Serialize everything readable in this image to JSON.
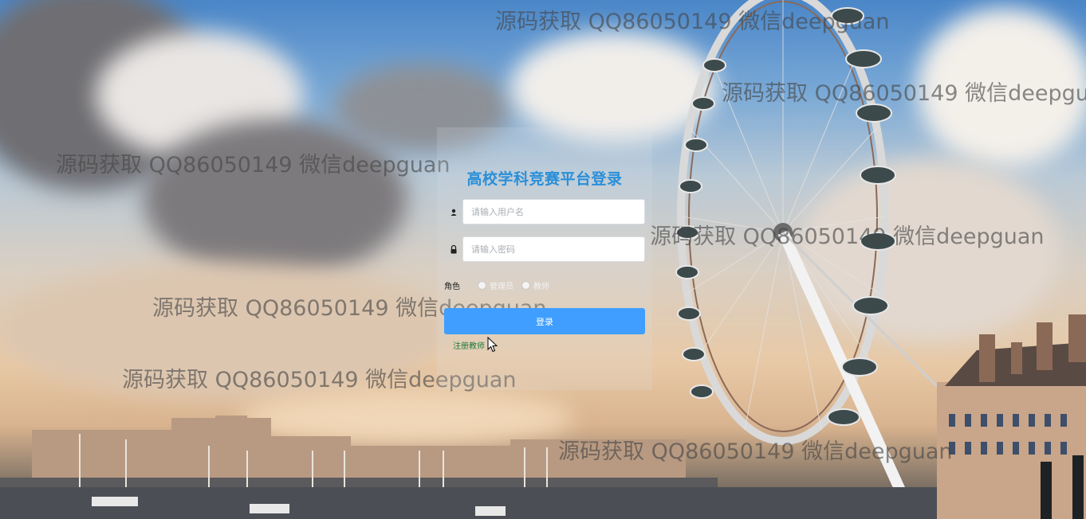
{
  "login": {
    "title": "高校学科竞赛平台登录",
    "username_placeholder": "请输入用户名",
    "password_placeholder": "请输入密码",
    "role_label": "角色",
    "role_options": [
      "管理员",
      "教师"
    ],
    "login_button": "登录",
    "register_link": "注册教师"
  },
  "watermark": {
    "text": "源码获取 QQ86050149 微信deepguan"
  },
  "colors": {
    "title": "#2a8fd8",
    "button": "#3f9eff",
    "link": "#1e7a3c"
  },
  "icons": [
    "user-icon",
    "lock-icon",
    "mouse-cursor-icon"
  ]
}
